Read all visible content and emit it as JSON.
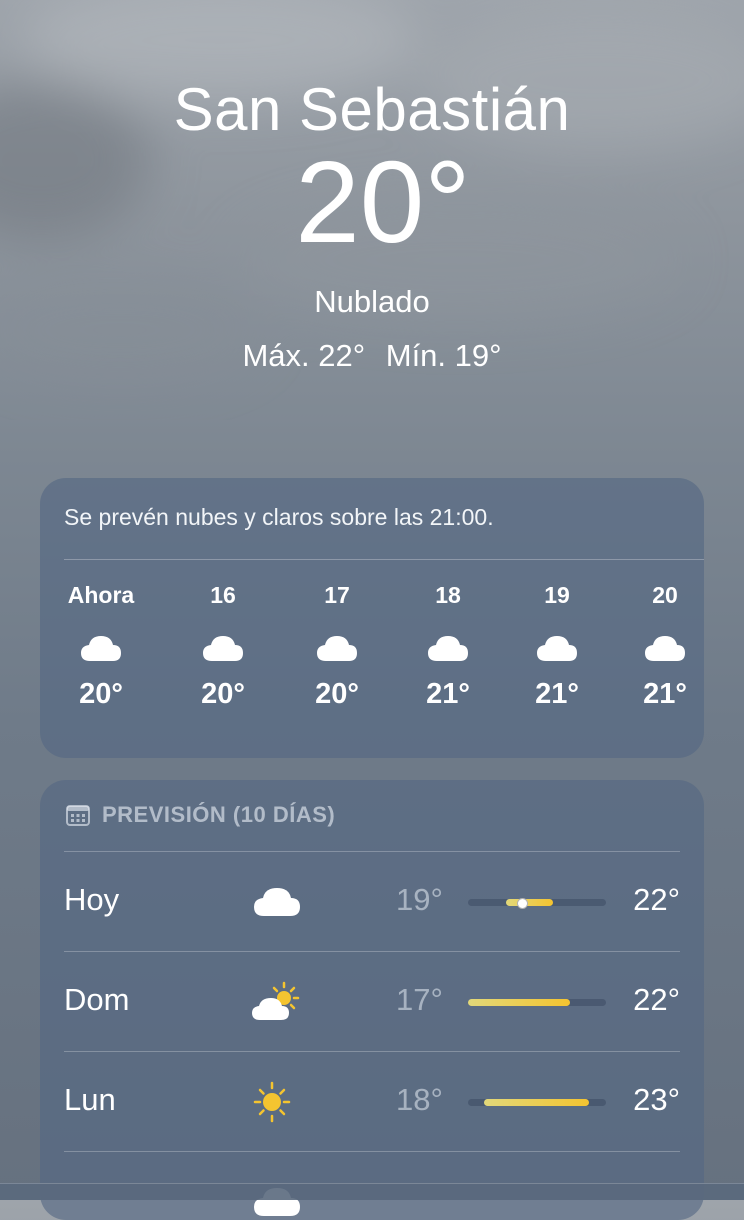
{
  "location": {
    "city": "San Sebastián",
    "temperature": "20°",
    "condition": "Nublado",
    "high": "Máx. 22°",
    "low": "Mín. 19°"
  },
  "hourly": {
    "summary": "Se prevén nubes y claros sobre las 21:00.",
    "items": [
      {
        "label": "Ahora",
        "icon": "cloud-icon",
        "temp": "20°"
      },
      {
        "label": "16",
        "icon": "cloud-icon",
        "temp": "20°"
      },
      {
        "label": "17",
        "icon": "cloud-icon",
        "temp": "20°"
      },
      {
        "label": "18",
        "icon": "cloud-icon",
        "temp": "21°"
      },
      {
        "label": "19",
        "icon": "cloud-icon",
        "temp": "21°"
      },
      {
        "label": "20",
        "icon": "cloud-icon",
        "temp": "21°"
      }
    ]
  },
  "forecast": {
    "title": "PREVISIÓN (10 DÍAS)",
    "header_icon": "calendar-icon",
    "days": [
      {
        "day": "Hoy",
        "icon": "cloud-icon",
        "low": "19°",
        "high": "22°",
        "range_start": 0.28,
        "range_end": 0.62,
        "current": 0.38
      },
      {
        "day": "Dom",
        "icon": "cloud-sun-icon",
        "low": "17°",
        "high": "22°",
        "range_start": 0.0,
        "range_end": 0.74
      },
      {
        "day": "Lun",
        "icon": "sun-icon",
        "low": "18°",
        "high": "23°",
        "range_start": 0.12,
        "range_end": 0.88
      }
    ],
    "partial_next_icon": "cloud-icon"
  },
  "colors": {
    "accent_bar": "#f4c430",
    "card": "#546782"
  }
}
